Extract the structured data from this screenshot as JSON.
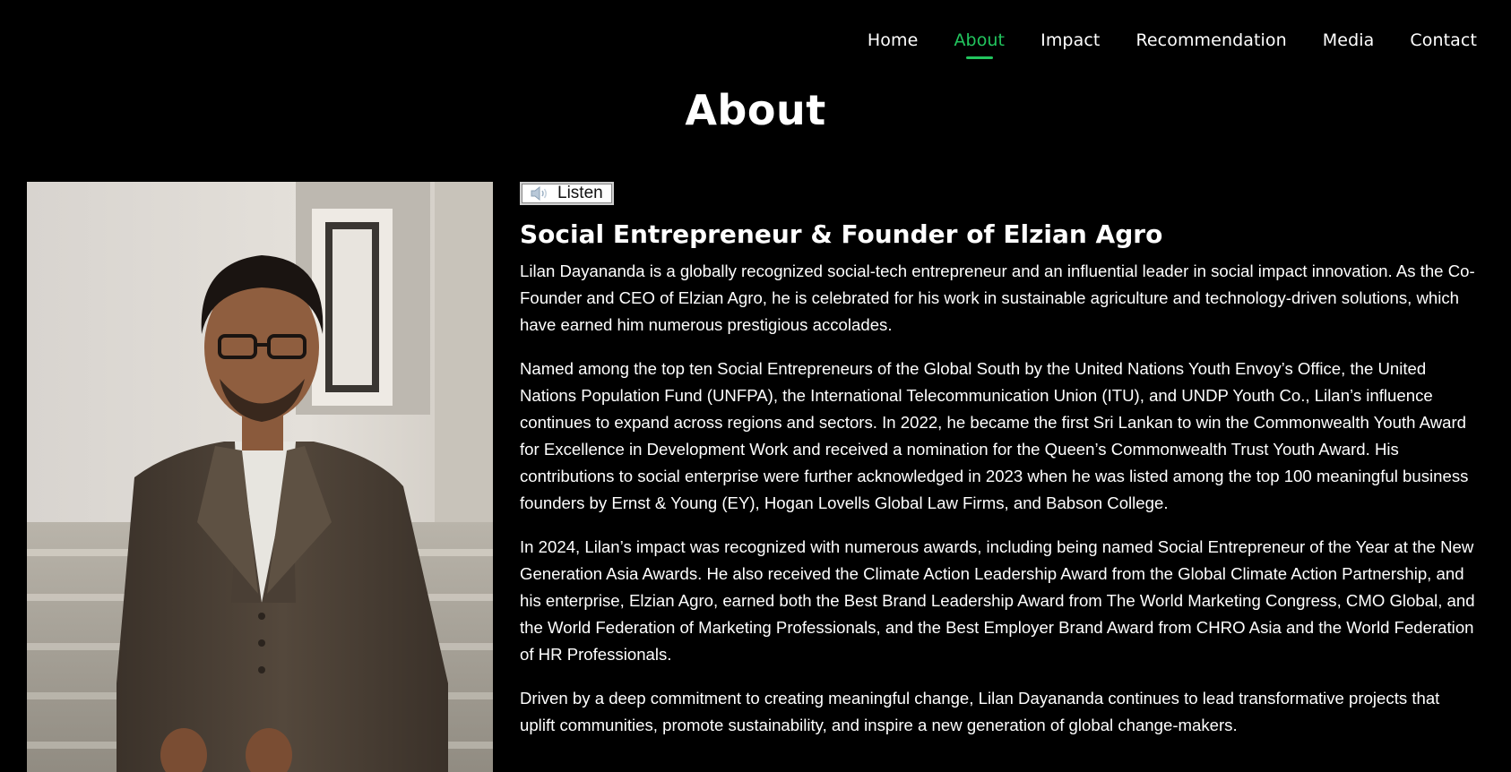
{
  "nav": {
    "items": [
      {
        "label": "Home",
        "active": false
      },
      {
        "label": "About",
        "active": true
      },
      {
        "label": "Impact",
        "active": false
      },
      {
        "label": "Recommendation",
        "active": false
      },
      {
        "label": "Media",
        "active": false
      },
      {
        "label": "Contact",
        "active": false
      }
    ],
    "accent_color": "#22c55e"
  },
  "page": {
    "title": "About",
    "background": "#000000"
  },
  "portrait": {
    "icon": "person-photo"
  },
  "content": {
    "listen_label": "Listen",
    "listen_icon": "speaker-icon",
    "heading": "Social Entrepreneur & Founder of Elzian Agro",
    "paragraphs": [
      "Lilan Dayananda is a globally recognized social-tech entrepreneur and an influential leader in social impact innovation. As the Co-Founder and CEO of Elzian Agro, he is celebrated for his work in sustainable agriculture and technology-driven solutions, which have earned him numerous prestigious accolades.",
      "Named among the top ten Social Entrepreneurs of the Global South by the United Nations Youth Envoy’s Office, the United Nations Population Fund (UNFPA), the International Telecommunication Union (ITU), and UNDP Youth Co., Lilan’s influence continues to expand across regions and sectors. In 2022, he became the first Sri Lankan to win the Commonwealth Youth Award for Excellence in Development Work and received a nomination for the Queen’s Commonwealth Trust Youth Award. His contributions to social enterprise were further acknowledged in 2023 when he was listed among the top 100 meaningful business founders by Ernst & Young (EY), Hogan Lovells Global Law Firms, and Babson College.",
      "In 2024, Lilan’s impact was recognized with numerous awards, including being named Social Entrepreneur of the Year at the New Generation Asia Awards. He also received the Climate Action Leadership Award from the Global Climate Action Partnership, and his enterprise, Elzian Agro, earned both the Best Brand Leadership Award from The World Marketing Congress, CMO Global, and the World Federation of Marketing Professionals, and the Best Employer Brand Award from CHRO Asia and the World Federation of HR Professionals.",
      "Driven by a deep commitment to creating meaningful change, Lilan Dayananda continues to lead transformative projects that uplift communities, promote sustainability, and inspire a new generation of global change-makers."
    ]
  }
}
